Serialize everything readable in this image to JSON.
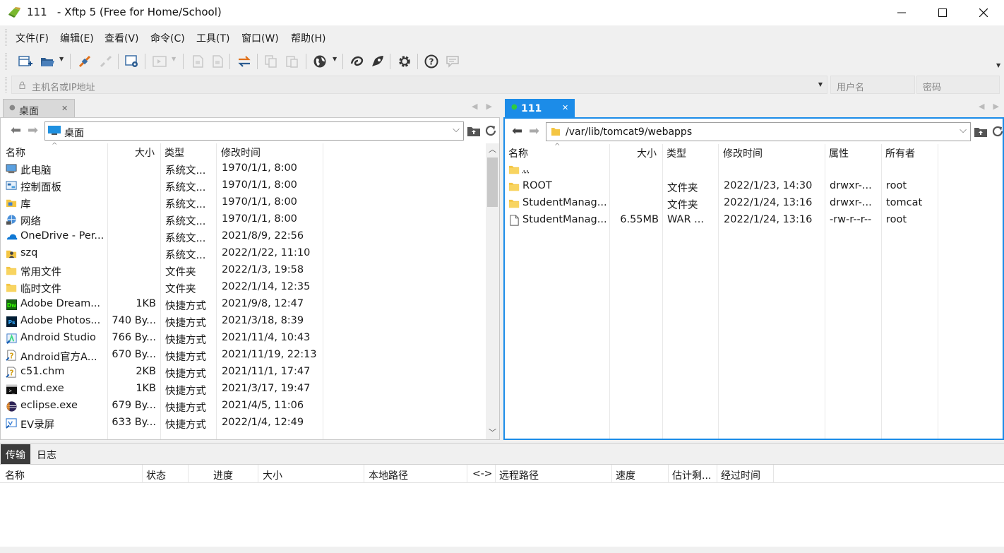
{
  "window": {
    "title": "111   - Xftp 5 (Free for Home/School)"
  },
  "menu": [
    "文件(F)",
    "编辑(E)",
    "查看(V)",
    "命令(C)",
    "工具(T)",
    "窗口(W)",
    "帮助(H)"
  ],
  "address": {
    "host_placeholder": "主机名或IP地址",
    "user_placeholder": "用户名",
    "pass_placeholder": "密码"
  },
  "left_pane": {
    "tab_label": "桌面",
    "path": "桌面",
    "columns": [
      "名称",
      "大小",
      "类型",
      "修改时间"
    ],
    "rows": [
      {
        "icon": "computer-icon",
        "name": "此电脑",
        "size": "",
        "type": "系统文...",
        "modified": "1970/1/1, 8:00"
      },
      {
        "icon": "control-panel-icon",
        "name": "控制面板",
        "size": "",
        "type": "系统文...",
        "modified": "1970/1/1, 8:00"
      },
      {
        "icon": "library-icon",
        "name": "库",
        "size": "",
        "type": "系统文...",
        "modified": "1970/1/1, 8:00"
      },
      {
        "icon": "network-icon",
        "name": "网络",
        "size": "",
        "type": "系统文...",
        "modified": "1970/1/1, 8:00"
      },
      {
        "icon": "onedrive-icon",
        "name": "OneDrive - Per...",
        "size": "",
        "type": "系统文...",
        "modified": "2021/8/9, 22:56"
      },
      {
        "icon": "user-folder-icon",
        "name": "szq",
        "size": "",
        "type": "系统文...",
        "modified": "2022/1/22, 11:10"
      },
      {
        "icon": "folder-icon",
        "name": "常用文件",
        "size": "",
        "type": "文件夹",
        "modified": "2022/1/3, 19:58"
      },
      {
        "icon": "folder-icon",
        "name": "临时文件",
        "size": "",
        "type": "文件夹",
        "modified": "2022/1/14, 12:35"
      },
      {
        "icon": "dreamweaver-icon",
        "name": "Adobe Dream...",
        "size": "1KB",
        "type": "快捷方式",
        "modified": "2021/9/8, 12:47"
      },
      {
        "icon": "photoshop-icon",
        "name": "Adobe Photos...",
        "size": "740 By...",
        "type": "快捷方式",
        "modified": "2021/3/18, 8:39"
      },
      {
        "icon": "android-studio-icon",
        "name": "Android Studio",
        "size": "766 By...",
        "type": "快捷方式",
        "modified": "2021/11/4, 10:43"
      },
      {
        "icon": "help-file-icon",
        "name": "Android官方A...",
        "size": "670 By...",
        "type": "快捷方式",
        "modified": "2021/11/19, 22:13"
      },
      {
        "icon": "help-file-icon",
        "name": "c51.chm",
        "size": "2KB",
        "type": "快捷方式",
        "modified": "2021/11/1, 17:47"
      },
      {
        "icon": "cmd-icon",
        "name": "cmd.exe",
        "size": "1KB",
        "type": "快捷方式",
        "modified": "2021/3/17, 19:47"
      },
      {
        "icon": "eclipse-icon",
        "name": "eclipse.exe",
        "size": "679 By...",
        "type": "快捷方式",
        "modified": "2021/4/5, 11:06"
      },
      {
        "icon": "ev-recorder-icon",
        "name": "EV录屏",
        "size": "633 By...",
        "type": "快捷方式",
        "modified": "2022/1/4, 12:49"
      }
    ]
  },
  "right_pane": {
    "tab_label": "111",
    "path": "/var/lib/tomcat9/webapps",
    "columns": [
      "名称",
      "大小",
      "类型",
      "修改时间",
      "属性",
      "所有者"
    ],
    "rows": [
      {
        "icon": "folder-icon",
        "name": "..",
        "size": "",
        "type": "",
        "modified": "",
        "attr": "",
        "owner": ""
      },
      {
        "icon": "folder-icon",
        "name": "ROOT",
        "size": "",
        "type": "文件夹",
        "modified": "2022/1/23, 14:30",
        "attr": "drwxr-...",
        "owner": "root"
      },
      {
        "icon": "folder-icon",
        "name": "StudentManag...",
        "size": "",
        "type": "文件夹",
        "modified": "2022/1/24, 13:16",
        "attr": "drwxr-...",
        "owner": "tomcat"
      },
      {
        "icon": "file-icon",
        "name": "StudentManag...",
        "size": "6.55MB",
        "type": "WAR ...",
        "modified": "2022/1/24, 13:16",
        "attr": "-rw-r--r--",
        "owner": "root"
      }
    ]
  },
  "bottom": {
    "tabs": [
      "传输",
      "日志"
    ],
    "columns": [
      "名称",
      "状态",
      "进度",
      "大小",
      "本地路径",
      "<->",
      "远程路径",
      "速度",
      "估计剩...",
      "经过时间"
    ]
  },
  "colors": {
    "accent": "#1c8ce8",
    "folder": "#f4c542",
    "connected_dot": "#2ecc40"
  }
}
